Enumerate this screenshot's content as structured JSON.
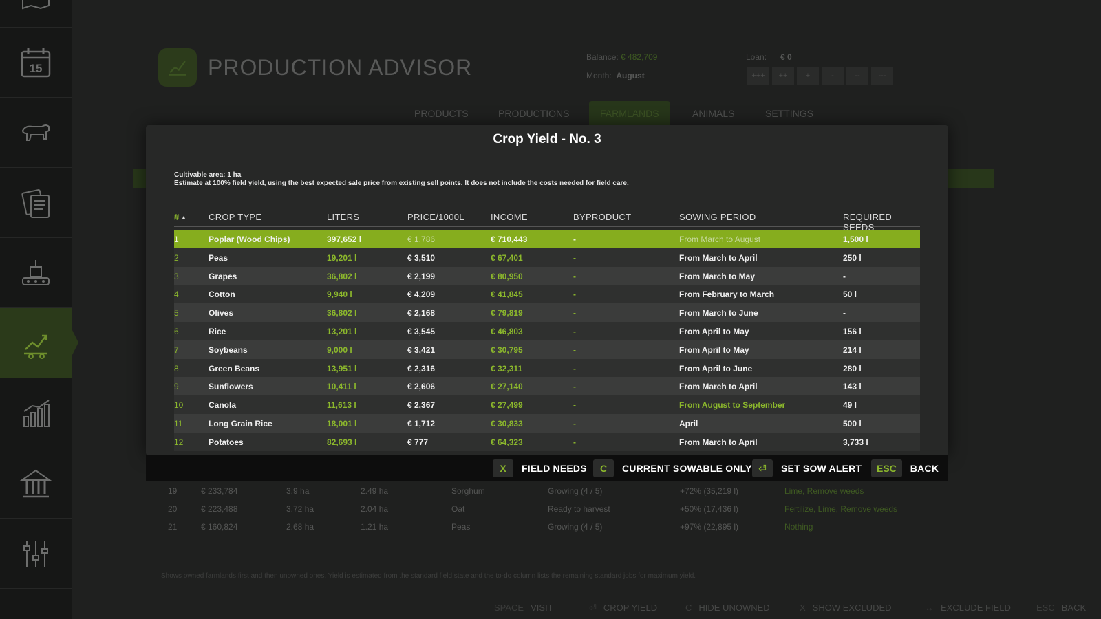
{
  "background": {
    "title": "PRODUCTION ADVISOR",
    "balance_label": "Balance:",
    "balance_value": "€ 482,709",
    "month_label": "Month:",
    "month_value": "August",
    "loan_label": "Loan:",
    "loan_value": "€ 0",
    "loan_buttons": [
      "+++",
      "++",
      "+",
      "-",
      "--",
      "---"
    ],
    "tabs": [
      "PRODUCTS",
      "PRODUCTIONS",
      "FARMLANDS",
      "ANIMALS",
      "SETTINGS"
    ],
    "active_tab": "FARMLANDS",
    "rows": [
      {
        "no": "19",
        "price": "€ 233,784",
        "area": "3.9 ha",
        "cult": "2.49 ha",
        "crop": "Sorghum",
        "state": "Growing (4 / 5)",
        "yield": "+72% (35,219 l)",
        "todo": "Lime, Remove weeds"
      },
      {
        "no": "20",
        "price": "€ 223,488",
        "area": "3.72 ha",
        "cult": "2.04 ha",
        "crop": "Oat",
        "state": "Ready to harvest",
        "yield": "+50% (17,436 l)",
        "todo": "Fertilize, Lime, Remove weeds"
      },
      {
        "no": "21",
        "price": "€ 160,824",
        "area": "2.68 ha",
        "cult": "1.21 ha",
        "crop": "Peas",
        "state": "Growing (4 / 5)",
        "yield": "+97% (22,895 l)",
        "todo": "Nothing"
      }
    ],
    "footnote": "Shows owned farmlands first and then unowned ones. Yield is estimated from the standard field state and the to-do column lists the remaining standard jobs for maximum yield.",
    "keys": [
      {
        "key": "SPACE",
        "label": "VISIT"
      },
      {
        "key": "⏎",
        "label": "CROP YIELD"
      },
      {
        "key": "C",
        "label": "HIDE UNOWNED"
      },
      {
        "key": "X",
        "label": "SHOW EXCLUDED"
      },
      {
        "key": "↔",
        "label": "EXCLUDE FIELD"
      },
      {
        "key": "ESC",
        "label": "BACK"
      }
    ]
  },
  "modal": {
    "title": "Crop Yield - No. 3",
    "area_text": "Cultivable area: 1 ha",
    "estimate_text": "Estimate at 100% field yield, using the best expected sale price from existing sell points. It does not include the costs needed for field care.",
    "columns": [
      "#",
      "CROP TYPE",
      "LITERS",
      "PRICE/1000L",
      "INCOME",
      "BYPRODUCT",
      "SOWING PERIOD",
      "REQUIRED SEEDS"
    ],
    "rows": [
      {
        "n": "1",
        "crop": "Poplar (Wood Chips)",
        "liters": "397,652 l",
        "price": "€ 1,786",
        "income": "€ 710,443",
        "byproduct": "-",
        "sowing": "From March to August",
        "seeds": "1,500 l",
        "selected": true
      },
      {
        "n": "2",
        "crop": "Peas",
        "liters": "19,201 l",
        "price": "€ 3,510",
        "income": "€ 67,401",
        "byproduct": "-",
        "sowing": "From March to April",
        "seeds": "250 l"
      },
      {
        "n": "3",
        "crop": "Grapes",
        "liters": "36,802 l",
        "price": "€ 2,199",
        "income": "€ 80,950",
        "byproduct": "-",
        "sowing": "From March to May",
        "seeds": "-"
      },
      {
        "n": "4",
        "crop": "Cotton",
        "liters": "9,940 l",
        "price": "€ 4,209",
        "income": "€ 41,845",
        "byproduct": "-",
        "sowing": "From February to March",
        "seeds": "50 l"
      },
      {
        "n": "5",
        "crop": "Olives",
        "liters": "36,802 l",
        "price": "€ 2,168",
        "income": "€ 79,819",
        "byproduct": "-",
        "sowing": "From March to June",
        "seeds": "-"
      },
      {
        "n": "6",
        "crop": "Rice",
        "liters": "13,201 l",
        "price": "€ 3,545",
        "income": "€ 46,803",
        "byproduct": "-",
        "sowing": "From April to May",
        "seeds": "156 l"
      },
      {
        "n": "7",
        "crop": "Soybeans",
        "liters": "9,000 l",
        "price": "€ 3,421",
        "income": "€ 30,795",
        "byproduct": "-",
        "sowing": "From April to May",
        "seeds": "214 l"
      },
      {
        "n": "8",
        "crop": "Green Beans",
        "liters": "13,951 l",
        "price": "€ 2,316",
        "income": "€ 32,311",
        "byproduct": "-",
        "sowing": "From April to June",
        "seeds": "280 l"
      },
      {
        "n": "9",
        "crop": "Sunflowers",
        "liters": "10,411 l",
        "price": "€ 2,606",
        "income": "€ 27,140",
        "byproduct": "-",
        "sowing": "From March to April",
        "seeds": "143 l"
      },
      {
        "n": "10",
        "crop": "Canola",
        "liters": "11,613 l",
        "price": "€ 2,367",
        "income": "€ 27,499",
        "byproduct": "-",
        "sowing": "From August to September",
        "seeds": "49 l",
        "sowing_current": true
      },
      {
        "n": "11",
        "crop": "Long Grain Rice",
        "liters": "18,001 l",
        "price": "€ 1,712",
        "income": "€ 30,833",
        "byproduct": "-",
        "sowing": "April",
        "seeds": "500 l"
      },
      {
        "n": "12",
        "crop": "Potatoes",
        "liters": "82,693 l",
        "price": "€ 777",
        "income": "€ 64,323",
        "byproduct": "-",
        "sowing": "From March to April",
        "seeds": "3,733 l"
      }
    ],
    "footer_keys": [
      {
        "key": "X",
        "label": "FIELD NEEDS"
      },
      {
        "key": "C",
        "label": "CURRENT SOWABLE ONLY"
      },
      {
        "key": "⏎",
        "label": "SET SOW ALERT"
      },
      {
        "key": "ESC",
        "label": "BACK"
      }
    ]
  },
  "sidebar": {
    "icons": [
      "map-icon",
      "calendar-icon",
      "animals-icon",
      "contracts-icon",
      "production-icon",
      "production-advisor-icon",
      "statistics-icon",
      "finances-icon",
      "settings-icon"
    ],
    "active_index": 5,
    "calendar_day": "15"
  }
}
